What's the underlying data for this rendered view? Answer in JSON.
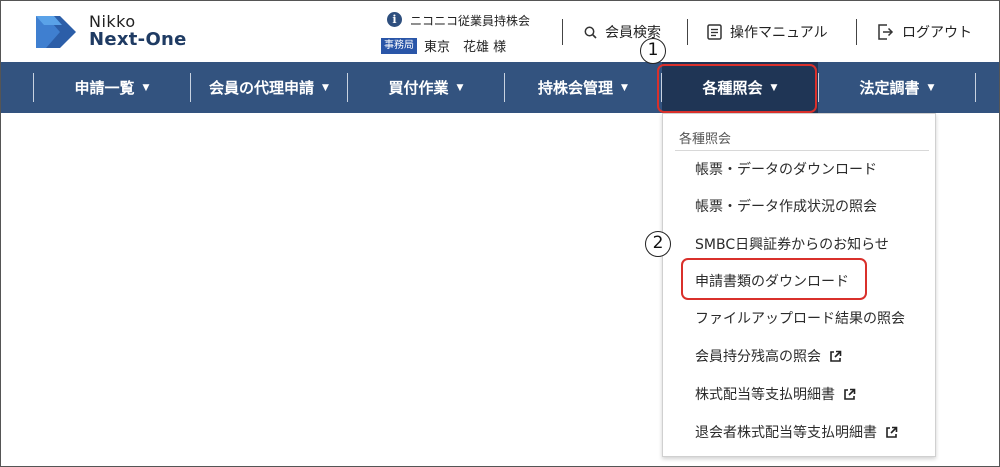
{
  "logo": {
    "line1": "Nikko",
    "line2": "Next-One"
  },
  "org": {
    "name": "ニコニコ従業員持株会",
    "role_badge": "事務局",
    "user": "東京　花雄 様"
  },
  "header_links": {
    "member_search": "会員検索",
    "manual": "操作マニュアル",
    "logout": "ログアウト"
  },
  "nav": {
    "items": [
      {
        "label": "申請一覧"
      },
      {
        "label": "会員の代理申請"
      },
      {
        "label": "買付作業"
      },
      {
        "label": "持株会管理"
      },
      {
        "label": "各種照会"
      },
      {
        "label": "法定調書"
      }
    ],
    "caret": "▼"
  },
  "dropdown": {
    "header": "各種照会",
    "items": [
      {
        "label": "帳票・データのダウンロード"
      },
      {
        "label": "帳票・データ作成状況の照会"
      },
      {
        "label": "SMBC日興証券からのお知らせ"
      },
      {
        "label": "申請書類のダウンロード"
      },
      {
        "label": "ファイルアップロード結果の照会"
      },
      {
        "label": "会員持分残高の照会"
      },
      {
        "label": "株式配当等支払明細書"
      },
      {
        "label": "退会者株式配当等支払明細書"
      }
    ]
  },
  "annotations": {
    "step1": "1",
    "step2": "2"
  },
  "colors": {
    "nav_bg": "#33537f",
    "nav_active": "#1f3555",
    "highlight": "#d9302b",
    "badge": "#2a56a8"
  }
}
